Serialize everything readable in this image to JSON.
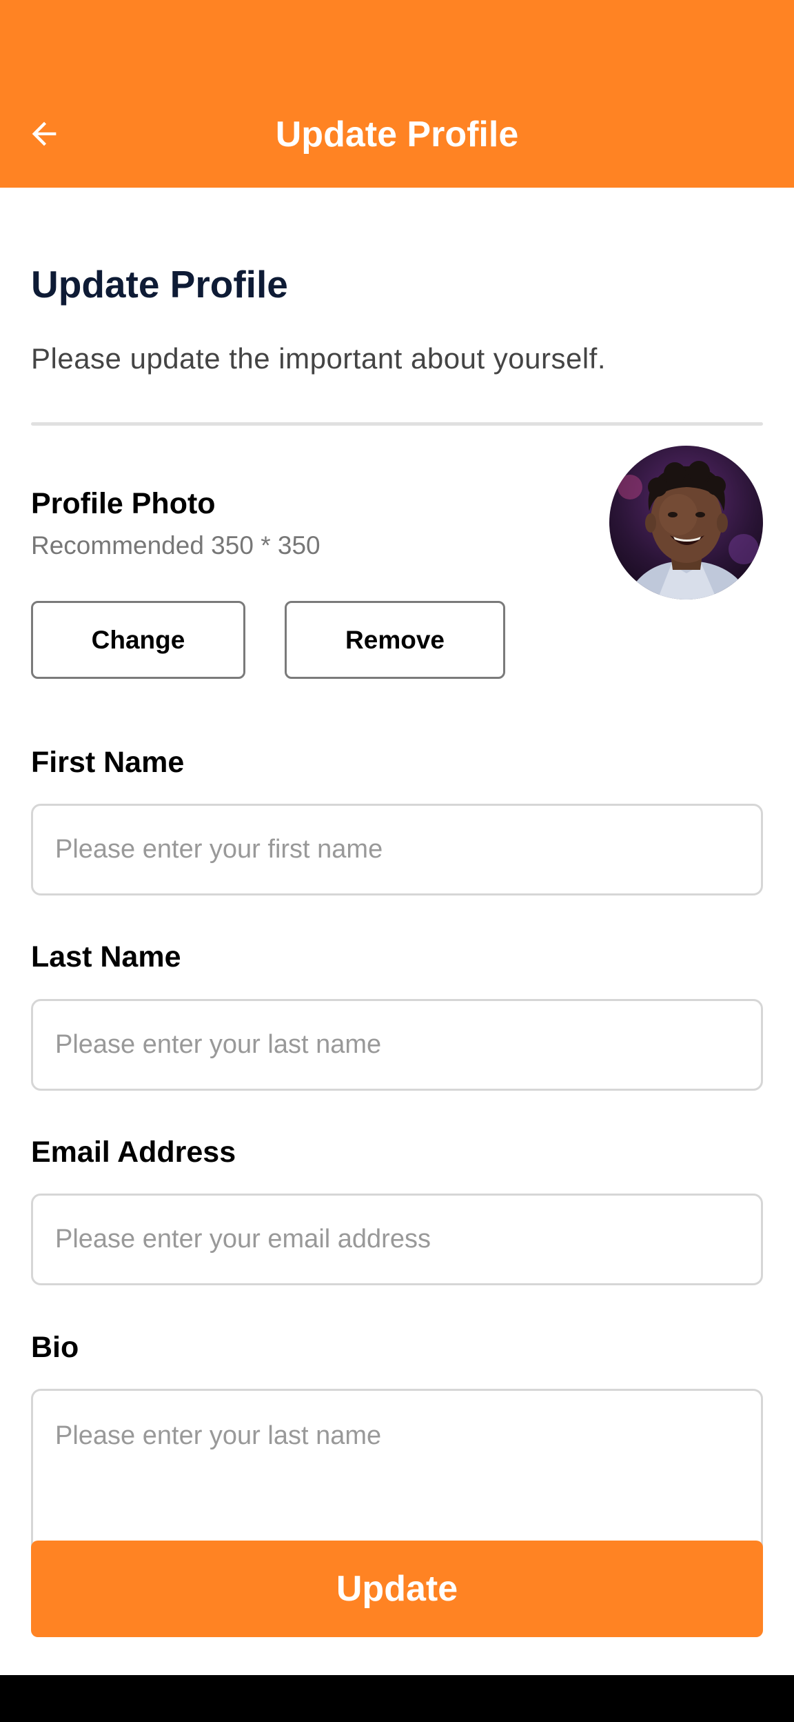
{
  "appbar": {
    "title": "Update Profile",
    "back_icon": "arrow-left-icon",
    "color": "#FF8323"
  },
  "header": {
    "title": "Update Profile",
    "subtitle": "Please update the important about yourself."
  },
  "profile_photo": {
    "label": "Profile Photo",
    "hint": "Recommended 350 * 350",
    "change_label": "Change",
    "remove_label": "Remove"
  },
  "form": {
    "first_name": {
      "label": "First Name",
      "placeholder": "Please enter your first name",
      "value": ""
    },
    "last_name": {
      "label": "Last Name",
      "placeholder": "Please enter your last name",
      "value": ""
    },
    "email": {
      "label": "Email Address",
      "placeholder": "Please enter your email address",
      "value": ""
    },
    "bio": {
      "label": "Bio",
      "placeholder": "Please enter your last name",
      "value": ""
    }
  },
  "actions": {
    "update_label": "Update"
  },
  "colors": {
    "accent": "#FF8323",
    "title_text": "#0E1B35",
    "input_border": "#D6D6D6"
  }
}
